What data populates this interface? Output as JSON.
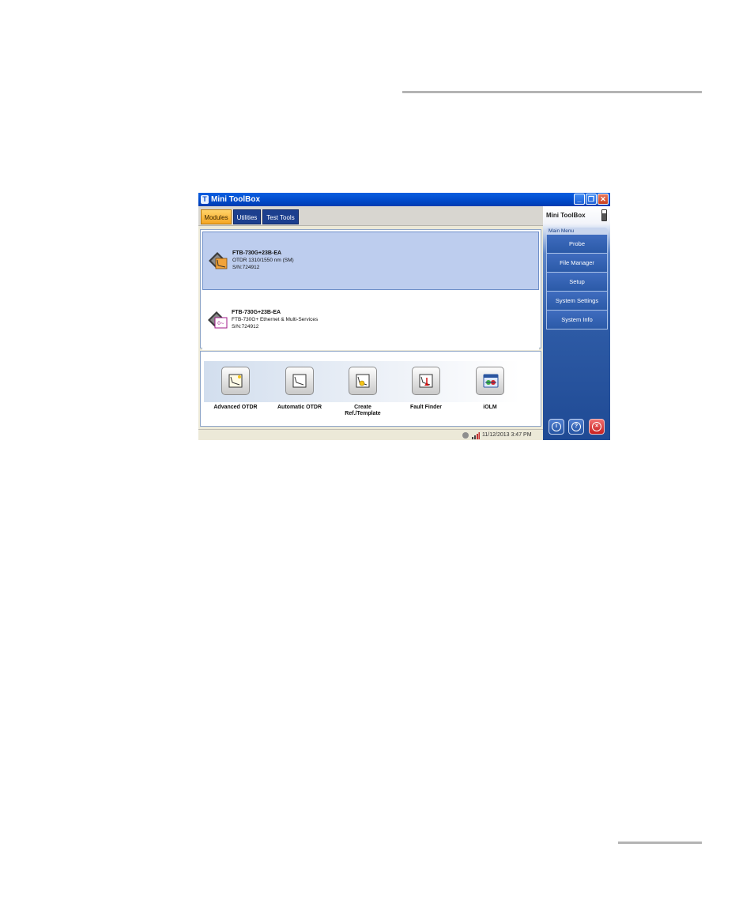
{
  "window": {
    "title": "Mini ToolBox",
    "app_icon_glyph": "T"
  },
  "tabs": [
    {
      "label": "Modules",
      "active": true
    },
    {
      "label": "Utilities",
      "active": false
    },
    {
      "label": "Test Tools",
      "active": false
    }
  ],
  "modules": [
    {
      "name": "FTB-730G+23B-EA",
      "description": "OTDR 1310/1550 nm (SM)",
      "serial": "S/N:724912",
      "selected": true,
      "icon": "otdr-module-icon"
    },
    {
      "name": "FTB-730G+23B-EA",
      "description": "FTB-730G+ Ethernet & Multi-Services",
      "serial": "S/N:724912",
      "selected": false,
      "icon": "ethernet-module-icon"
    }
  ],
  "apps": [
    {
      "label": "Advanced OTDR",
      "icon": "advanced-otdr-icon"
    },
    {
      "label": "Automatic OTDR",
      "icon": "automatic-otdr-icon"
    },
    {
      "label": "Create Ref./Template",
      "icon": "create-template-icon"
    },
    {
      "label": "Fault Finder",
      "icon": "fault-finder-icon"
    },
    {
      "label": "iOLM",
      "icon": "iolm-icon"
    }
  ],
  "status": {
    "datetime": "11/12/2013 3:47 PM"
  },
  "sidebar": {
    "title": "Mini ToolBox",
    "menu_header": "Main Menu",
    "items": [
      {
        "label": "Probe"
      },
      {
        "label": "File Manager"
      },
      {
        "label": "Setup"
      },
      {
        "label": "System Settings"
      },
      {
        "label": "System Info"
      }
    ],
    "bottom_buttons": [
      {
        "icon": "info-icon",
        "glyph": "i"
      },
      {
        "icon": "help-icon",
        "glyph": "?"
      },
      {
        "icon": "exit-icon",
        "glyph": "×"
      }
    ]
  },
  "colors": {
    "accent_tab": "#f5a623",
    "selection": "#bdcdee",
    "titlebar": "#0a5ee0",
    "sidebar": "#2d5aa5"
  }
}
